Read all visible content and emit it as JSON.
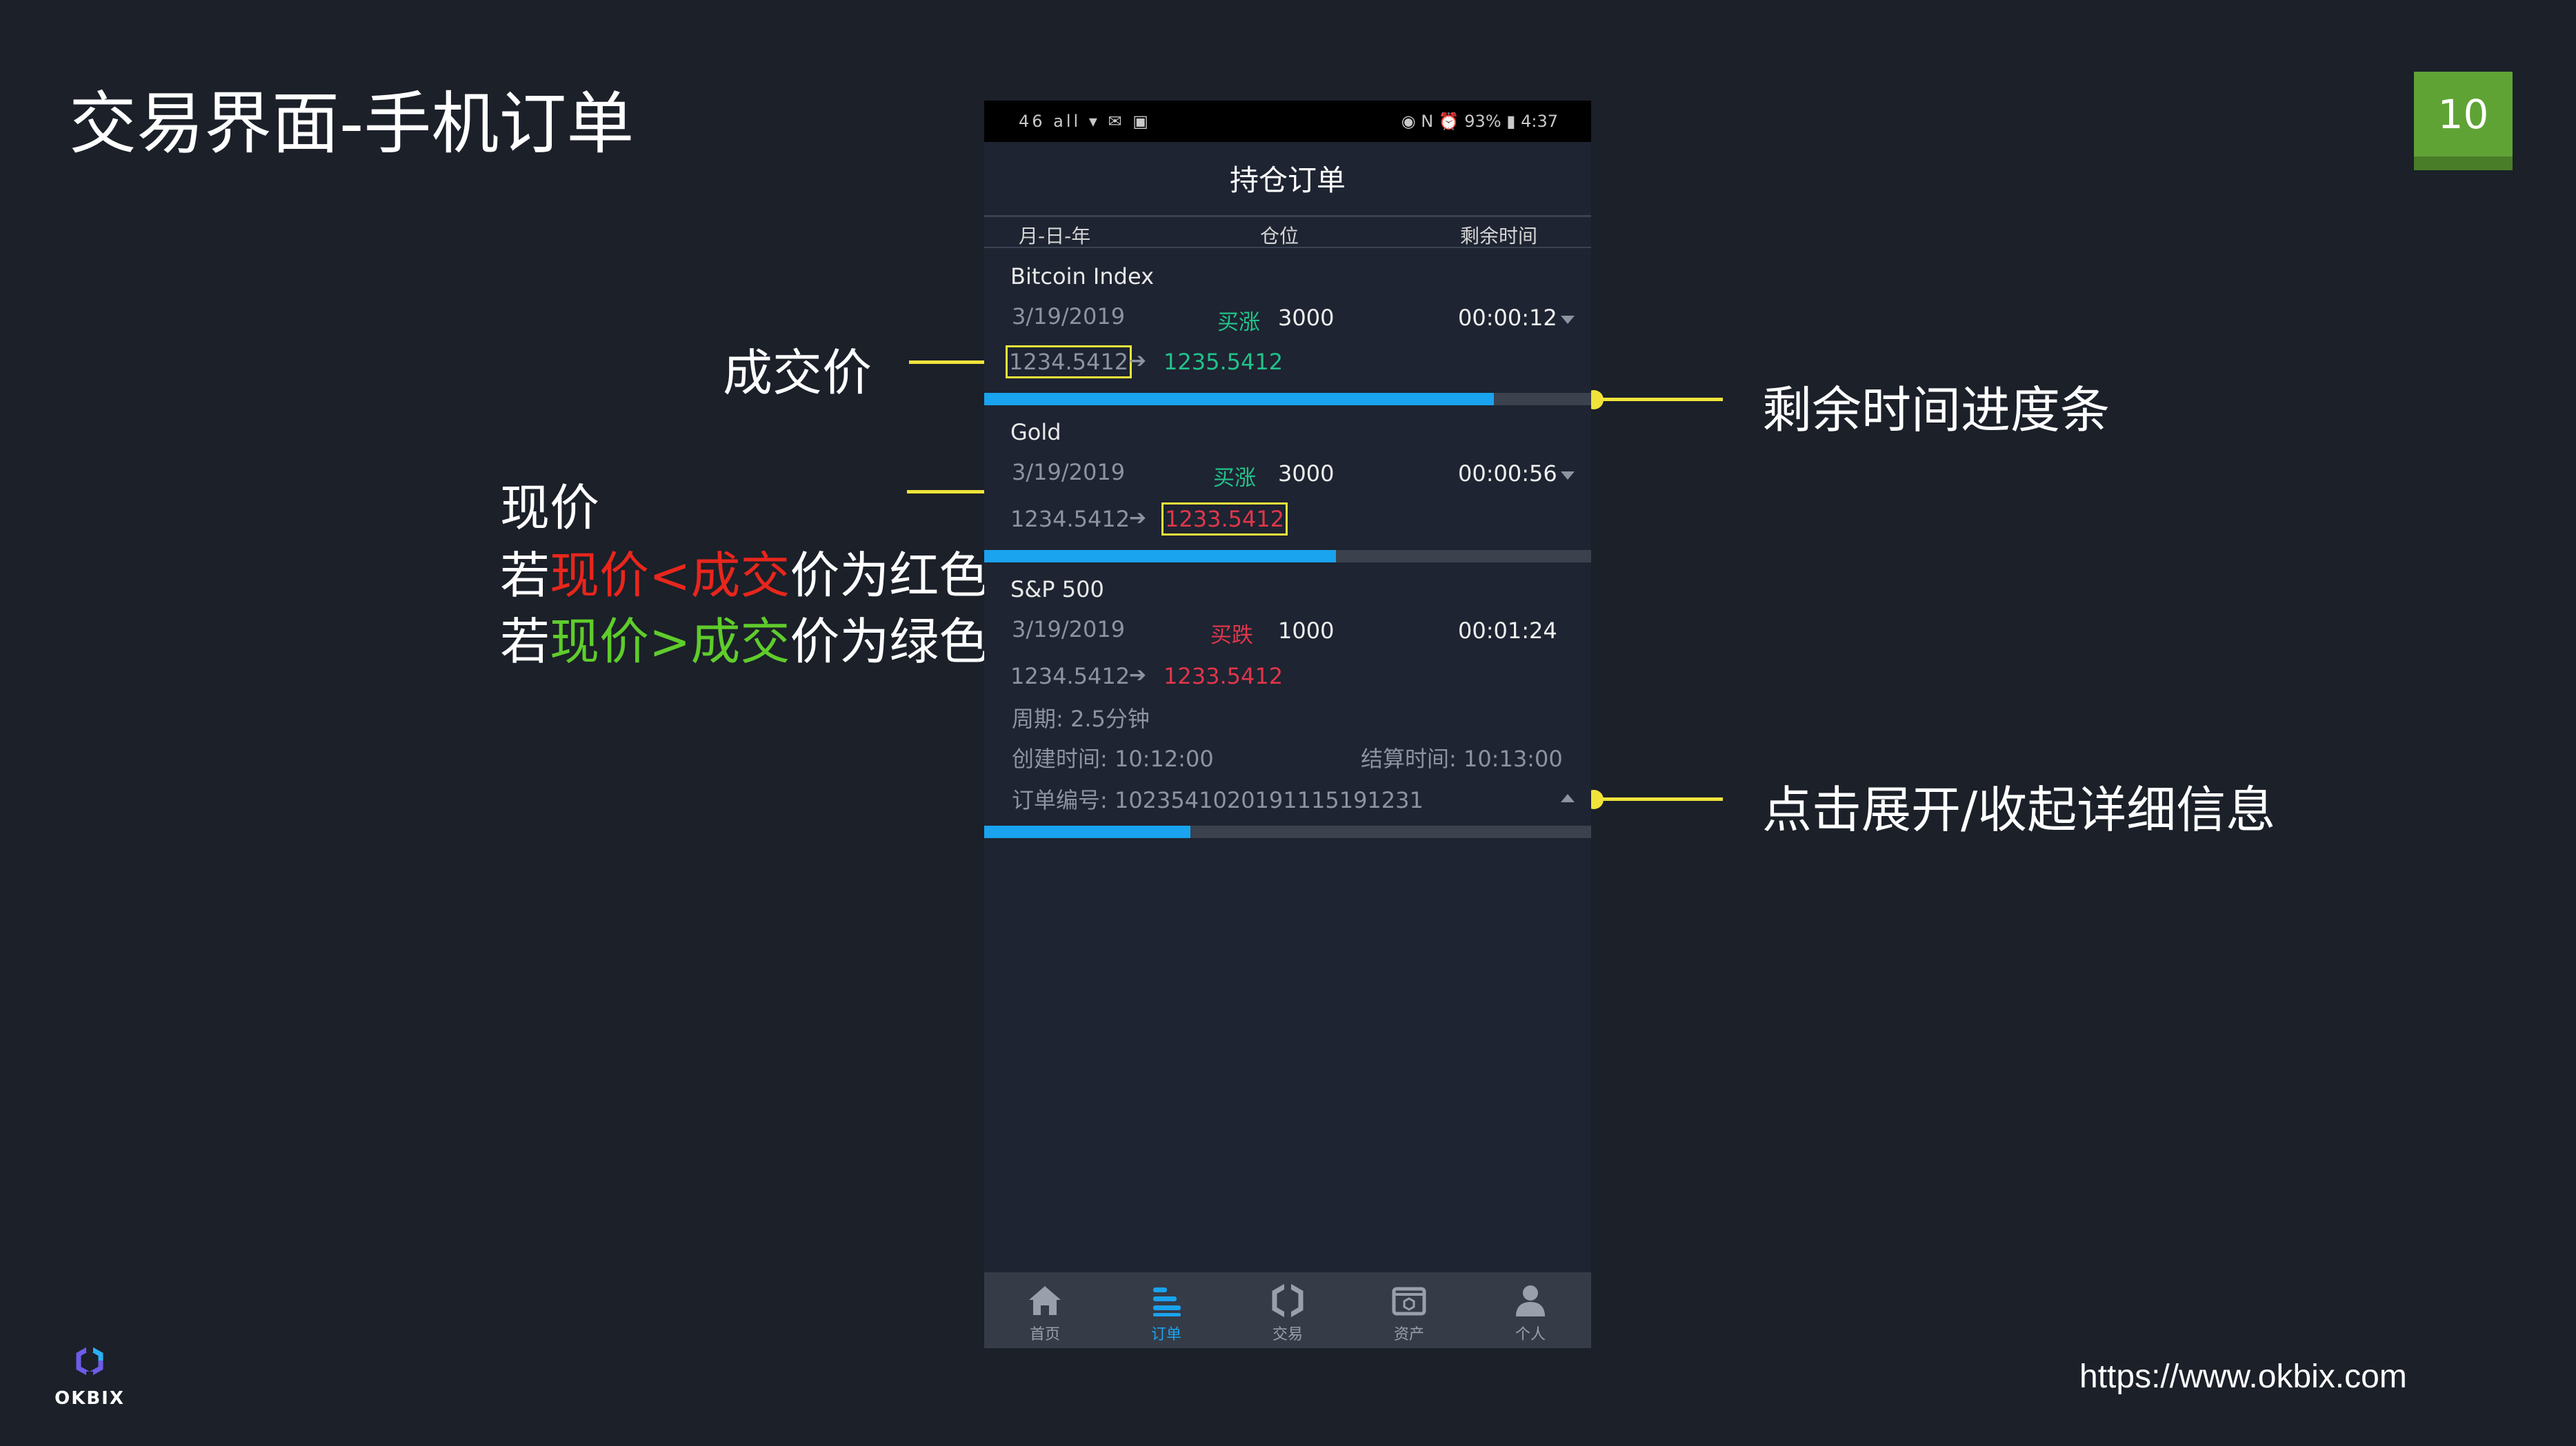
{
  "slide": {
    "title": "交易界面-手机订单",
    "page_number": "10",
    "url": "https://www.okbix.com",
    "logo_text": "OKBIX",
    "colors": {
      "background": "#1b2029",
      "accent_green": "#5fa335",
      "callout_yellow": "#f0e43a"
    }
  },
  "annotations": {
    "deal_price": "成交价",
    "current_price": "现价",
    "rule_red": {
      "prefix": "若",
      "current": "现价",
      "op": "<",
      "deal": "成交",
      "suffix": "价为红色"
    },
    "rule_green": {
      "prefix": "若",
      "current": "现价",
      "op": ">",
      "deal": "成交",
      "suffix": "价为绿色"
    },
    "remaining_bar": "剩余时间进度条",
    "expand": "点击展开/收起详细信息"
  },
  "phone": {
    "status": {
      "left": "46 all ▾ ✉ ▣",
      "right": "◉ N ⏰ 93% ▮ 4:37"
    },
    "title": "持仓订单",
    "columns": [
      "月-日-年",
      "仓位",
      "剩余时间"
    ],
    "orders": [
      {
        "name": "Bitcoin Index",
        "date": "3/19/2019",
        "direction": "买涨",
        "direction_color": "#22c28a",
        "quantity": "3000",
        "remaining": "00:00:12",
        "deal_price": "1234.5412",
        "arrow": "➔",
        "current_price": "1235.5412",
        "current_color": "#22c28a",
        "progress": 0.84,
        "expanded": false
      },
      {
        "name": "Gold",
        "date": "3/19/2019",
        "direction": "买涨",
        "direction_color": "#22c28a",
        "quantity": "3000",
        "remaining": "00:00:56",
        "deal_price": "1234.5412",
        "arrow": "➔",
        "current_price": "1233.5412",
        "current_color": "#e0364b",
        "progress": 0.58,
        "expanded": false
      },
      {
        "name": "S&P 500",
        "date": "3/19/2019",
        "direction": "买跌",
        "direction_color": "#e0364b",
        "quantity": "1000",
        "remaining": "00:01:24",
        "deal_price": "1234.5412",
        "arrow": "➔",
        "current_price": "1233.5412",
        "current_color": "#e0364b",
        "progress": 0.34,
        "expanded": true,
        "period": "周期: 2.5分钟",
        "created": "创建时间: 10:12:00",
        "settle": "结算时间: 10:13:00",
        "order_no": "订单编号: 102354102019111519123​1"
      }
    ],
    "tabs": [
      {
        "label": "首页",
        "icon": "home-icon",
        "active": false
      },
      {
        "label": "订单",
        "icon": "orders-icon",
        "active": true
      },
      {
        "label": "交易",
        "icon": "trade-icon",
        "active": false
      },
      {
        "label": "资产",
        "icon": "wallet-icon",
        "active": false
      },
      {
        "label": "个人",
        "icon": "user-icon",
        "active": false
      }
    ]
  }
}
